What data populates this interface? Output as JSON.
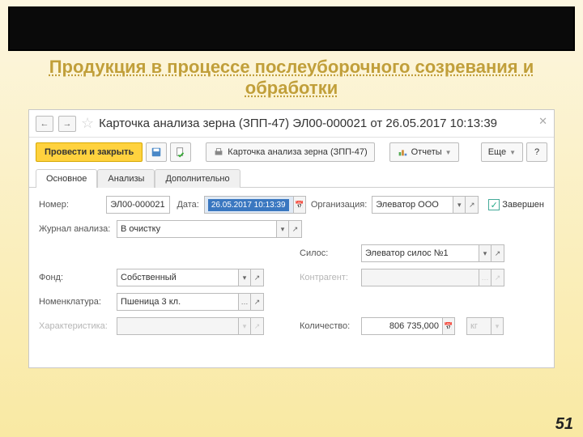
{
  "banner": {
    "line1": "Продукция в процессе послеуборочного созревания и",
    "line2": "обработки"
  },
  "window": {
    "title": "Карточка анализа зерна (ЗПП-47) ЭЛ00-000021 от 26.05.2017 10:13:39"
  },
  "toolbar": {
    "primary": "Провести и закрыть",
    "card_btn": "Карточка анализа зерна (ЗПП-47)",
    "reports": "Отчеты",
    "more": "Еще",
    "help": "?"
  },
  "tabs": {
    "main": "Основное",
    "analyses": "Анализы",
    "extra": "Дополнительно"
  },
  "form": {
    "number_lbl": "Номер:",
    "number_val": "ЭЛ00-000021",
    "date_lbl": "Дата:",
    "date_val": "26.05.2017 10:13:39",
    "org_lbl": "Организация:",
    "org_val": "Элеватор ООО",
    "completed_lbl": "Завершен",
    "journal_lbl": "Журнал анализа:",
    "journal_val": "В очистку",
    "silo_lbl": "Силос:",
    "silo_val": "Элеватор силос №1",
    "fund_lbl": "Фонд:",
    "fund_val": "Собственный",
    "counterparty_lbl": "Контрагент:",
    "counterparty_val": "",
    "nomen_lbl": "Номенклатура:",
    "nomen_val": "Пшеница 3 кл.",
    "char_lbl": "Характеристика:",
    "char_val": "",
    "qty_lbl": "Количество:",
    "qty_val": "806 735,000",
    "unit_val": "кг"
  },
  "page_num": "51"
}
